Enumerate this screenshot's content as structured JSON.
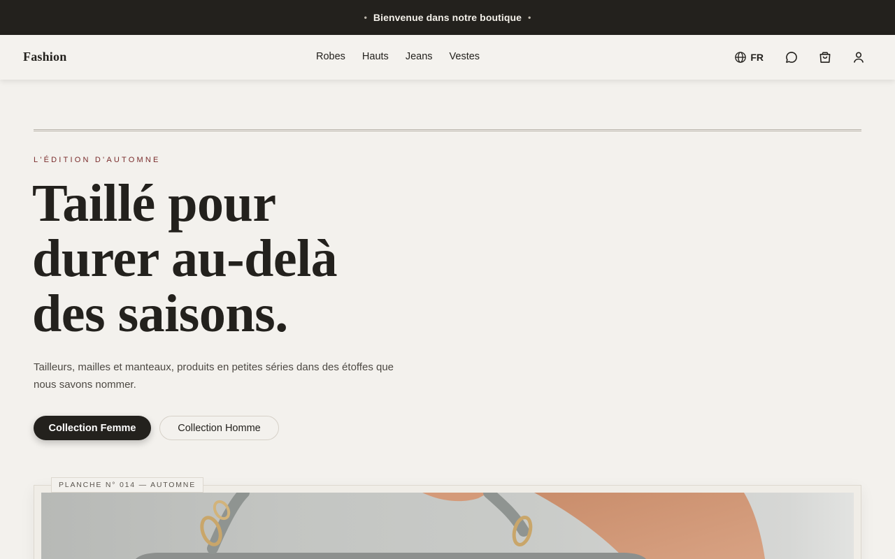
{
  "announcement": {
    "text": "Bienvenue dans notre boutique"
  },
  "header": {
    "logo": "Fashion",
    "nav": [
      "Robes",
      "Hauts",
      "Jeans",
      "Vestes"
    ],
    "language": "FR"
  },
  "hero": {
    "eyebrow": "L'ÉDITION D'AUTOMNE",
    "headline": [
      "Taillé pour",
      "durer au-delà",
      "des saisons."
    ],
    "subtext_lines": [
      "Tailleurs, mailles et manteaux, produits en petites séries dans des étoffes que",
      "nous savons nommer."
    ],
    "primary_cta": "Collection Femme",
    "secondary_cta": "Collection Homme"
  },
  "plate": {
    "label": "PLANCHE N° 014 — AUTOMNE"
  },
  "icons": {
    "language": "globe-icon",
    "chat": "chat-bubble-icon",
    "cart": "shopping-bag-icon",
    "account": "user-icon"
  },
  "colors": {
    "background": "#f3f1ed",
    "dark": "#23211d",
    "accent": "#7a2c2c"
  }
}
